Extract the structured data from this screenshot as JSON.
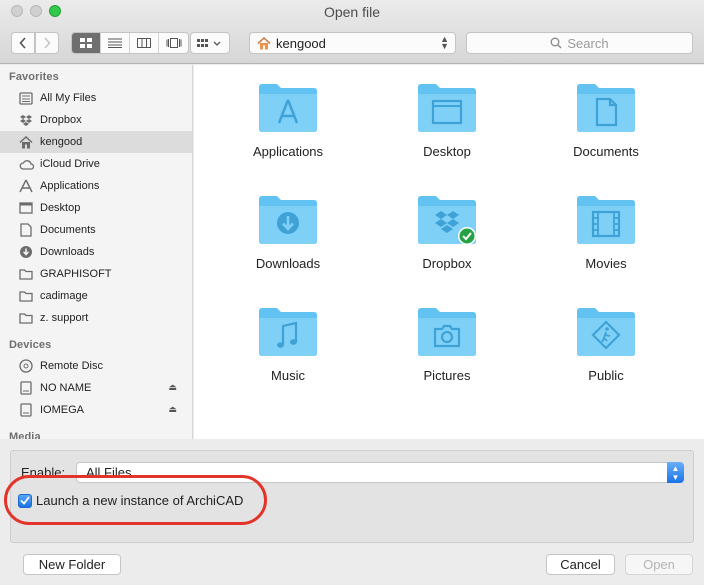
{
  "window": {
    "title": "Open file"
  },
  "toolbar": {
    "path_label": "kengood",
    "search_placeholder": "Search"
  },
  "sidebar": {
    "favorites_heading": "Favorites",
    "favorites": [
      {
        "label": "All My Files",
        "icon": "all-files-icon"
      },
      {
        "label": "Dropbox",
        "icon": "dropbox-icon"
      },
      {
        "label": "kengood",
        "icon": "home-icon",
        "selected": true
      },
      {
        "label": "iCloud Drive",
        "icon": "cloud-icon"
      },
      {
        "label": "Applications",
        "icon": "applications-icon"
      },
      {
        "label": "Desktop",
        "icon": "desktop-icon"
      },
      {
        "label": "Documents",
        "icon": "documents-icon"
      },
      {
        "label": "Downloads",
        "icon": "downloads-icon"
      },
      {
        "label": "GRAPHISOFT",
        "icon": "folder-icon"
      },
      {
        "label": "cadimage",
        "icon": "folder-icon"
      },
      {
        "label": "z. support",
        "icon": "folder-icon"
      }
    ],
    "devices_heading": "Devices",
    "devices": [
      {
        "label": "Remote Disc",
        "icon": "disc-icon"
      },
      {
        "label": "NO NAME",
        "icon": "drive-icon",
        "eject": true
      },
      {
        "label": "IOMEGA",
        "icon": "drive-icon",
        "eject": true
      }
    ],
    "media_heading": "Media"
  },
  "content": {
    "items": [
      {
        "name": "Applications",
        "icon": "applications-folder-icon"
      },
      {
        "name": "Desktop",
        "icon": "desktop-folder-icon"
      },
      {
        "name": "Documents",
        "icon": "documents-folder-icon"
      },
      {
        "name": "Downloads",
        "icon": "downloads-folder-icon"
      },
      {
        "name": "Dropbox",
        "icon": "dropbox-folder-icon"
      },
      {
        "name": "Movies",
        "icon": "movies-folder-icon"
      },
      {
        "name": "Music",
        "icon": "music-folder-icon"
      },
      {
        "name": "Pictures",
        "icon": "pictures-folder-icon"
      },
      {
        "name": "Public",
        "icon": "public-folder-icon"
      }
    ]
  },
  "panel": {
    "enable_label": "Enable:",
    "enable_value": "All Files",
    "launch_checkbox_label": "Launch a new instance of ArchiCAD",
    "launch_checked": true
  },
  "buttons": {
    "new_folder": "New Folder",
    "cancel": "Cancel",
    "open": "Open"
  },
  "colors": {
    "folder_blue": "#62c3f2",
    "accent": "#1b74e4",
    "highlight_red": "#e3342a"
  }
}
